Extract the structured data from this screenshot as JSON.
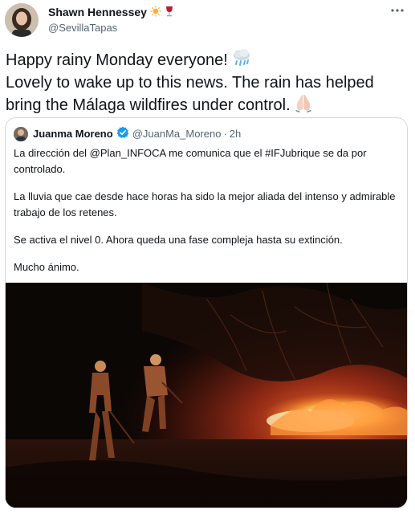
{
  "author": {
    "name": "Shawn Hennessey",
    "handle": "@SevillaTapas",
    "name_emojis": [
      "sun-emoji",
      "wine-glass-emoji"
    ]
  },
  "more_icon": "more-options-icon",
  "tweet": {
    "line1": "Happy rainy Monday everyone!",
    "line1_emoji": "cloud-with-rain-emoji",
    "line2": "Lovely to wake up to this news. The rain has helped bring the Málaga wildfires under control.",
    "line2_emoji": "folded-hands-emoji"
  },
  "quoted": {
    "name": "Juanma Moreno",
    "verified_icon": "verified-badge-icon",
    "handle": "@JuanMa_Moreno",
    "separator": "·",
    "time": "2h",
    "paragraphs": [
      "La dirección del @Plan_INFOCA me comunica que el #IFJubrique se da por controlado.",
      "La lluvia que cae desde hace horas ha sido la mejor aliada del intenso y admirable trabajo de los retenes.",
      "Se activa el nivel 0. Ahora queda una fase compleja hasta su extinción.",
      "Mucho ánimo."
    ],
    "media": "night-wildfire-firefighters-photo"
  },
  "colors": {
    "text": "#0f1419",
    "secondary": "#536471",
    "border": "#cfd9de",
    "verified": "#1d9bf0"
  }
}
